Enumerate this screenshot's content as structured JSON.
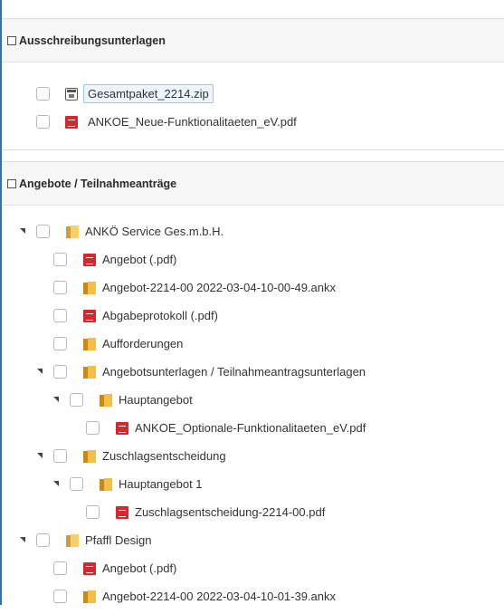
{
  "panel1": {
    "title": "Ausschreibungsunterlagen",
    "files": [
      {
        "name": "Gesamtpaket_2214.zip",
        "icon": "zip-file-icon",
        "selected": true
      },
      {
        "name": "ANKOE_Neue-Funktionalitaeten_eV.pdf",
        "icon": "pdf-file-icon",
        "selected": false
      }
    ]
  },
  "panel2": {
    "title": "Angebote / Teilnahmeanträge",
    "tree": [
      {
        "label": "ANKÖ Service Ges.m.b.H.",
        "icon": "company-folder-icon",
        "level": 0,
        "expand": true
      },
      {
        "label": "Angebot (.pdf)",
        "icon": "pdf-file-icon",
        "level": 1,
        "expand": false
      },
      {
        "label": "Angebot-2214-00 2022-03-04-10-00-49.ankx",
        "icon": "folder-icon",
        "level": 1,
        "expand": false
      },
      {
        "label": "Abgabeprotokoll (.pdf)",
        "icon": "pdf-file-icon",
        "level": 1,
        "expand": false
      },
      {
        "label": "Aufforderungen",
        "icon": "folder-icon",
        "level": 1,
        "expand": false
      },
      {
        "label": "Angebotsunterlagen / Teilnahmeantragsunterlagen",
        "icon": "folder-icon",
        "level": 1,
        "expand": true
      },
      {
        "label": "Hauptangebot",
        "icon": "folder-icon",
        "level": 2,
        "expand": true
      },
      {
        "label": "ANKOE_Optionale-Funktionalitaeten_eV.pdf",
        "icon": "pdf-file-icon",
        "level": 3,
        "expand": false
      },
      {
        "label": "Zuschlagsentscheidung",
        "icon": "folder-icon",
        "level": 1,
        "expand": true
      },
      {
        "label": "Hauptangebot 1",
        "icon": "folder-icon",
        "level": 2,
        "expand": true
      },
      {
        "label": "Zuschlagsentscheidung-2214-00.pdf",
        "icon": "pdf-file-icon",
        "level": 3,
        "expand": false
      },
      {
        "label": "Pfaffl Design",
        "icon": "company-folder-icon",
        "level": 0,
        "expand": true
      },
      {
        "label": "Angebot (.pdf)",
        "icon": "pdf-file-icon",
        "level": 1,
        "expand": false
      },
      {
        "label": "Angebot-2214-00 2022-03-04-10-01-39.ankx",
        "icon": "folder-icon",
        "level": 1,
        "expand": false
      }
    ]
  }
}
